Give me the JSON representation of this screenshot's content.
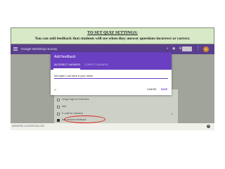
{
  "banner": {
    "title": "TO SET QUIZ SETTINGS:",
    "body": "You can add feedback that students will see when they answer questions incorrect or correct."
  },
  "app": {
    "form_title": "Google Workshop Survey",
    "header_icons": [
      "palette-icon",
      "eye-icon",
      "settings-icon"
    ],
    "send_label": "",
    "avatar_letter": "A"
  },
  "question": {
    "options": [
      {
        "label": "Image tags for Selection",
        "checked": false
      },
      {
        "label": "Add",
        "checked": false
      },
      {
        "label": "E-mail for Libraries",
        "checked": false
      },
      {
        "label": "Add answer feedback",
        "checked": true
      }
    ],
    "add_question_label": "Add question"
  },
  "dialog": {
    "title": "Add feedback",
    "tabs": [
      {
        "label": "INCORRECT ANSWERS",
        "active": true
      },
      {
        "label": "CORRECT ANSWERS",
        "active": false
      }
    ],
    "input_value": "Not quite! Look back in your notes!",
    "cancel_label": "CANCEL",
    "save_label": "SAVE"
  },
  "footer": {
    "text": "ANSWERS.CLASSROOM.COM"
  },
  "colors": {
    "banner_bg": "#d7e9c6",
    "header_purple": "#5a3f8d",
    "dialog_purple": "#6a3fc1",
    "highlight_red": "#e0211b"
  }
}
